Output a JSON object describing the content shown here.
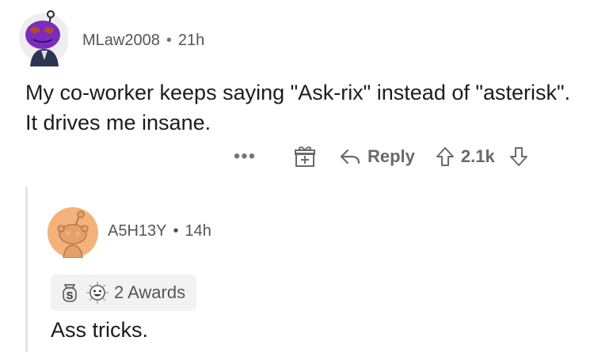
{
  "comment": {
    "username": "MLaw2008",
    "separator": "•",
    "age": "21h",
    "text": "My co-worker keeps saying \"Ask-rix\" instead of \"asterisk\". It drives me insane.",
    "actions": {
      "more": "•••",
      "reply_label": "Reply",
      "score": "2.1k"
    }
  },
  "reply": {
    "username": "A5H13Y",
    "separator": "•",
    "age": "14h",
    "awards_label": "2 Awards",
    "text": "Ass tricks."
  },
  "icons": [
    "snoo-avatar-purple-icon",
    "gift-icon",
    "reply-arrow-icon",
    "upvote-icon",
    "downvote-icon",
    "snoo-avatar-default-icon",
    "silver-award-icon",
    "wholesome-award-icon"
  ],
  "colors": {
    "avatar_purple": "#7b2cbf",
    "avatar_orange_bg": "#f4b27a",
    "meta_gray": "#555555",
    "icon_gray": "#6a6a6a",
    "awards_bg": "#f2f2f2",
    "thread_line": "#e4e4e4"
  }
}
